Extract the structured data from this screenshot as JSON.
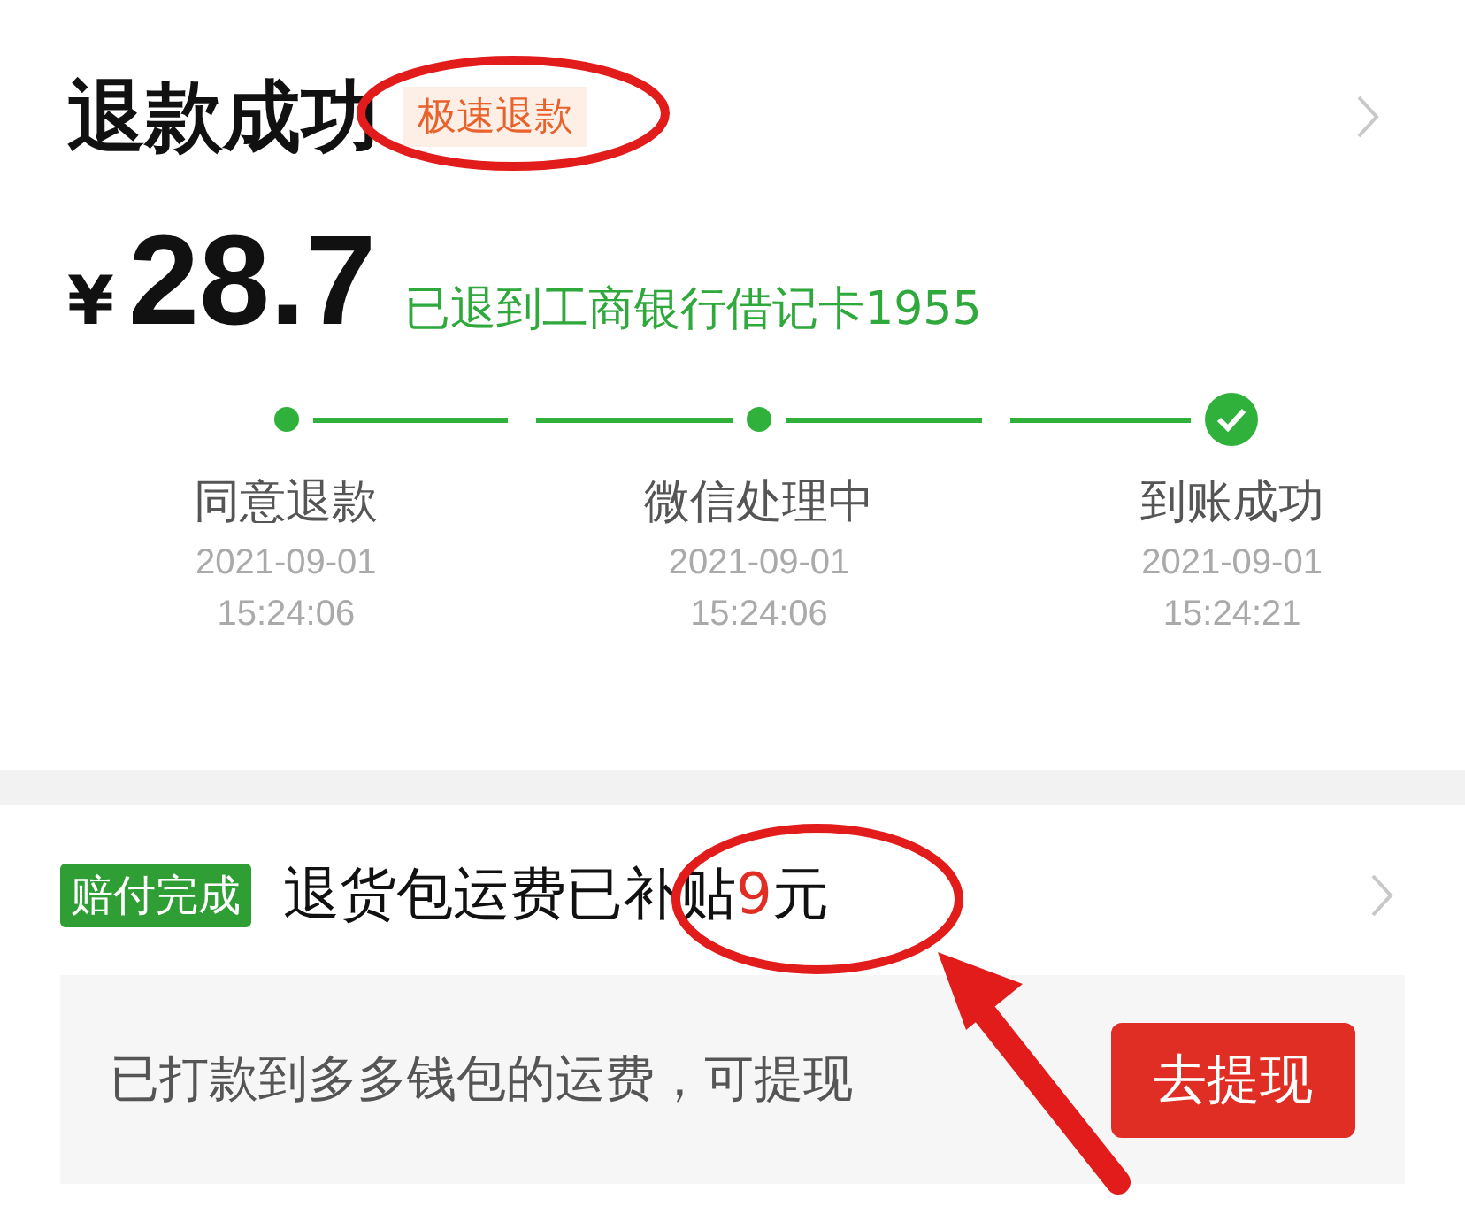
{
  "refund": {
    "title": "退款成功",
    "badge": "极速退款",
    "currency": "¥",
    "amount": "28.7",
    "destination": "已退到工商银行借记卡1955"
  },
  "steps": [
    {
      "label": "同意退款",
      "date": "2021-09-01",
      "time": "15:24:06",
      "done": true,
      "kind": "dot"
    },
    {
      "label": "微信处理中",
      "date": "2021-09-01",
      "time": "15:24:06",
      "done": true,
      "kind": "dot"
    },
    {
      "label": "到账成功",
      "date": "2021-09-01",
      "time": "15:24:21",
      "done": true,
      "kind": "check"
    }
  ],
  "compensation": {
    "badge": "赔付完成",
    "text_before": "退货包运费已补贴",
    "amount": "9",
    "text_after": "元",
    "note": "已打款到多多钱包的运费，可提现",
    "button": "去提现"
  }
}
